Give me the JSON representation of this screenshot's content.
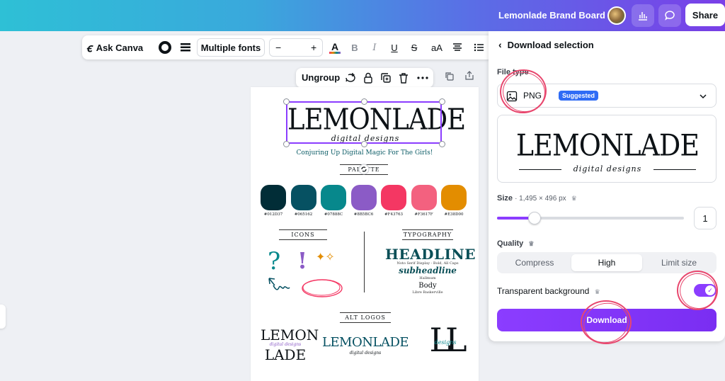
{
  "topbar": {
    "board_title": "Lemonlade Brand Board",
    "share_label": "Share",
    "icons": [
      "insights-icon",
      "comment-icon"
    ]
  },
  "toolbar": {
    "ask_canva": "Ask Canva",
    "fonts": "Multiple fonts",
    "size_minus": "−",
    "size_plus": "+",
    "bold": "B",
    "italic": "I",
    "underline": "U",
    "strike": "S",
    "case": "aA"
  },
  "element_toolbar": {
    "ungroup": "Ungroup"
  },
  "page": {
    "logo": "LEMONLADE",
    "logo_sub": "digital designs",
    "tagline": "Conjuring Up Digital Magic For The Girls!",
    "palette_hdr": "PALETTE",
    "palette": [
      {
        "hex": "#012D37",
        "color": "#012d37"
      },
      {
        "hex": "#065162",
        "color": "#065162"
      },
      {
        "hex": "#07888C",
        "color": "#07888c"
      },
      {
        "hex": "#8B5BC6",
        "color": "#8b5bc6"
      },
      {
        "hex": "#F43763",
        "color": "#f43763"
      },
      {
        "hex": "#F3617F",
        "color": "#f3617f"
      },
      {
        "hex": "#E38D00",
        "color": "#e38d00"
      }
    ],
    "icons_hdr": "ICONS",
    "typography_hdr": "TYPOGRAPHY",
    "headline": "HEADLINE",
    "headline_font": "Noto Serif Display - Bold, All Caps",
    "subheadline": "subheadline",
    "subheadline_font": "Hallmum",
    "body": "Body",
    "body_font": "Libre Baskerville",
    "alt_logos_hdr": "ALT LOGOS",
    "alt_logo_1_top": "LEMON",
    "alt_logo_1_mid": "digital designs",
    "alt_logo_1_bot": "LADE",
    "alt_logo_2": "LEMONLADE",
    "alt_logo_2_sub": "digital designs",
    "alt_logo_3": "LL",
    "alt_logo_3_sub": "designs"
  },
  "panel": {
    "title": "Download selection",
    "file_type_label": "File type",
    "file_type_value": "PNG",
    "suggested_badge": "Suggested",
    "preview_logo": "LEMONLADE",
    "preview_sub": "digital designs",
    "size_label": "Size",
    "size_dims": "· 1,495 × 496 px",
    "size_value": "1",
    "size_slider_fraction": 0.2,
    "quality_label": "Quality",
    "quality_options": [
      "Compress",
      "High",
      "Limit size"
    ],
    "quality_selected": "High",
    "transparent_label": "Transparent background",
    "transparent_on": true,
    "download_label": "Download"
  },
  "colors": {
    "accent": "#8b3dff",
    "annotation": "#e8476e",
    "badge": "#2f6cf5"
  }
}
